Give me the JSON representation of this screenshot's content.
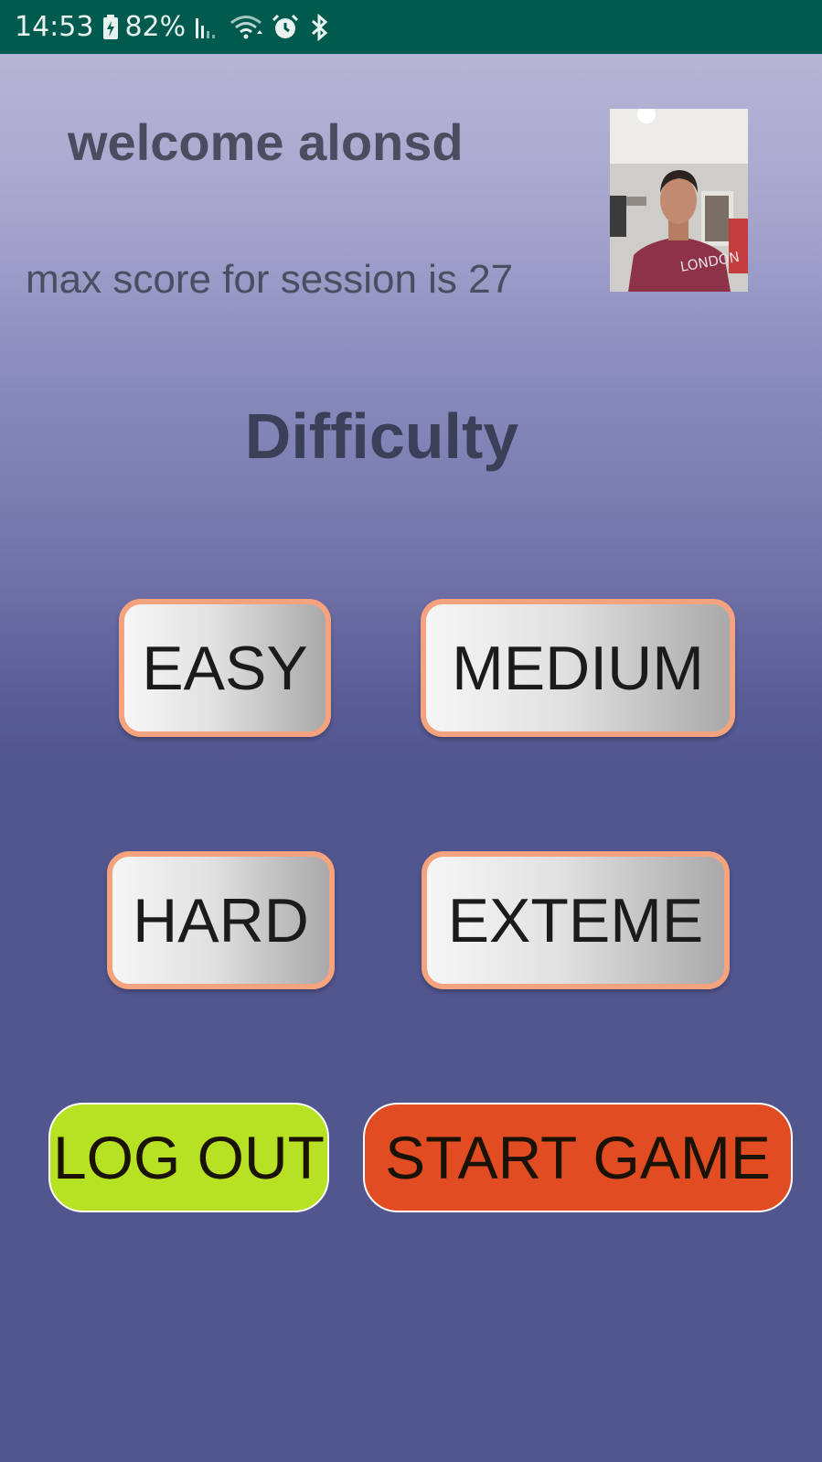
{
  "status_bar": {
    "time": "14:53",
    "battery_percent": "82%",
    "icons": [
      "battery-charging-icon",
      "signal-icon",
      "wifi-icon",
      "alarm-icon",
      "bluetooth-icon"
    ]
  },
  "header": {
    "welcome_text": "welcome alonsd",
    "max_score_text": "max score for session is 27"
  },
  "profile_photo": {
    "description_icon": "user-photo"
  },
  "difficulty": {
    "title": "Difficulty",
    "options": [
      {
        "label": "EASY"
      },
      {
        "label": "MEDIUM"
      },
      {
        "label": "HARD"
      },
      {
        "label": "EXTEME"
      }
    ]
  },
  "actions": {
    "logout_label": "LOG OUT",
    "start_label": "START GAME"
  },
  "colors": {
    "status_bar_bg": "#005a4d",
    "background_top": "#b7b5d5",
    "background_bottom": "#52568f",
    "difficulty_border": "#f4a37e",
    "logout_bg": "#b7e123",
    "start_bg": "#e14c22"
  }
}
